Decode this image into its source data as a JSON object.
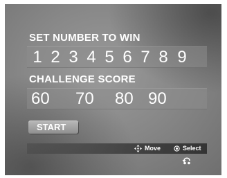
{
  "win_section": {
    "title": "SET NUMBER TO WIN",
    "numbers": [
      "1",
      "2",
      "3",
      "4",
      "5",
      "6",
      "7",
      "8",
      "9"
    ]
  },
  "score_section": {
    "title": "CHALLENGE SCORE",
    "scores": [
      "60",
      "70",
      "80",
      "90"
    ]
  },
  "start_button": {
    "label": "START"
  },
  "footer": {
    "move_label": "Move",
    "move_icon": "dpad-arrows-icon",
    "select_label": "Select",
    "select_icon": "select-button-icon",
    "return_icon": "return-arrow-icon"
  },
  "colors": {
    "text": "#ffffff",
    "background": "#8c8c8c"
  }
}
